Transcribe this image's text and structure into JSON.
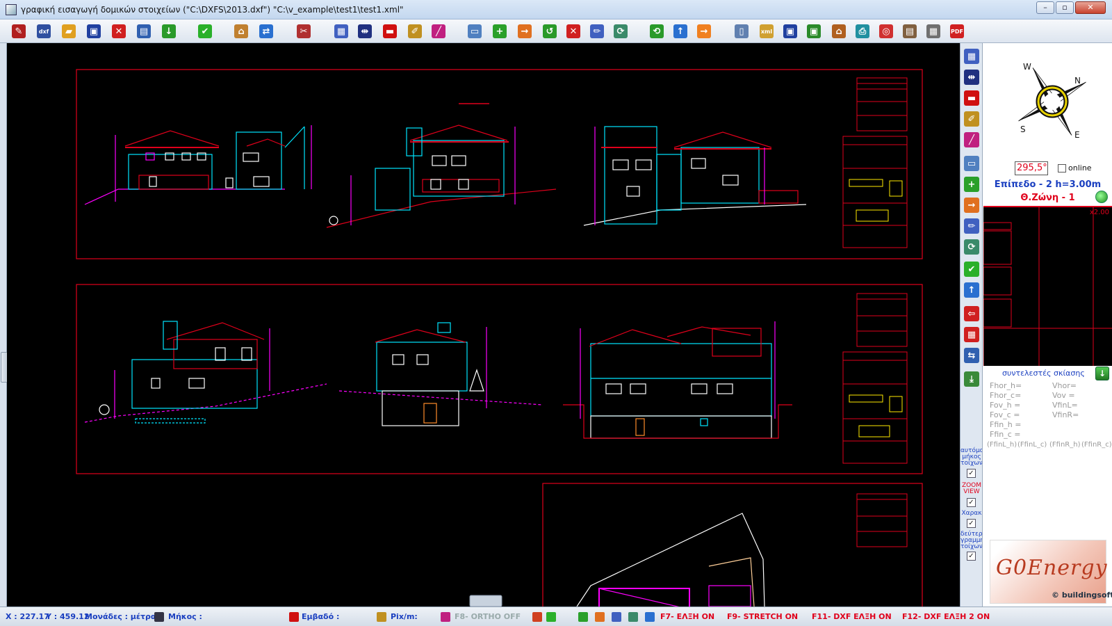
{
  "window": {
    "title": "γραφική εισαγωγή δομικών στοιχείων (\"C:\\DXFS\\2013.dxf\") \"C:\\v_example\\test1\\test1.xml\"",
    "minimize": "–",
    "maximize": "▫",
    "close": "✕"
  },
  "toolbar": {
    "items": [
      {
        "name": "edit-tool",
        "glyph": "✎",
        "color": "#b02020"
      },
      {
        "name": "dxf-import",
        "glyph": "dxf",
        "color": "#3050a0"
      },
      {
        "name": "open-folder",
        "glyph": "▰",
        "color": "#e0a020"
      },
      {
        "name": "save",
        "glyph": "▣",
        "color": "#2040a0"
      },
      {
        "name": "cancel",
        "glyph": "✕",
        "color": "#d02020"
      },
      {
        "name": "layers",
        "glyph": "▤",
        "color": "#3060b0"
      },
      {
        "name": "down-arrow",
        "glyph": "↓",
        "color": "#2a9a2a"
      },
      {
        "name": "confirm",
        "glyph": "✔",
        "color": "#2ab02a"
      },
      {
        "name": "building",
        "glyph": "⌂",
        "color": "#c08030"
      },
      {
        "name": "swap",
        "glyph": "⇄",
        "color": "#2a70d0"
      },
      {
        "name": "tools",
        "glyph": "✂",
        "color": "#b03030"
      },
      {
        "name": "plan-view",
        "glyph": "▦",
        "color": "#4060c0"
      },
      {
        "name": "dimension",
        "glyph": "⇹",
        "color": "#203080"
      },
      {
        "name": "wall",
        "glyph": "▬",
        "color": "#d01010"
      },
      {
        "name": "draw",
        "glyph": "✐",
        "color": "#c09020"
      },
      {
        "name": "line",
        "glyph": "╱",
        "color": "#c02080"
      },
      {
        "name": "page",
        "glyph": "▭",
        "color": "#5080c0"
      },
      {
        "name": "add",
        "glyph": "+",
        "color": "#2aa02a"
      },
      {
        "name": "move",
        "glyph": "→",
        "color": "#e07020"
      },
      {
        "name": "undo",
        "glyph": "↺",
        "color": "#2a9a2a"
      },
      {
        "name": "delete",
        "glyph": "✕",
        "color": "#d02020"
      },
      {
        "name": "edit-line",
        "glyph": "✏",
        "color": "#4060c0"
      },
      {
        "name": "rotate",
        "glyph": "⟳",
        "color": "#3a8a6a"
      },
      {
        "name": "refresh",
        "glyph": "⟲",
        "color": "#2a9a2a"
      },
      {
        "name": "up",
        "glyph": "↑",
        "color": "#2a70d0"
      },
      {
        "name": "forward",
        "glyph": "→",
        "color": "#f08020"
      },
      {
        "name": "new-doc",
        "glyph": "▯",
        "color": "#6080b0"
      },
      {
        "name": "xml",
        "glyph": "xml",
        "color": "#d0a030"
      },
      {
        "name": "save-2",
        "glyph": "▣",
        "color": "#2040a0"
      },
      {
        "name": "save-green",
        "glyph": "▣",
        "color": "#2a8a2a"
      },
      {
        "name": "building-report",
        "glyph": "⌂",
        "color": "#b06020"
      },
      {
        "name": "print",
        "glyph": "⎙",
        "color": "#2090a0"
      },
      {
        "name": "target",
        "glyph": "◎",
        "color": "#d03030"
      },
      {
        "name": "clipboard",
        "glyph": "▤",
        "color": "#806040"
      },
      {
        "name": "calculator",
        "glyph": "▦",
        "color": "#707070"
      },
      {
        "name": "pdf",
        "glyph": "PDF",
        "color": "#d02020"
      }
    ]
  },
  "right_tools": {
    "labels": {
      "auto_length": "αυτόμα\nμήκος\nτοίχων",
      "zoom_view": "ZOOM\nVIEW",
      "charak": "Χαρακ",
      "second_line": "δεύτερη\nγραμμή\nτοίχων"
    }
  },
  "side_panel": {
    "angle": "295,5°",
    "online_label": "online",
    "level": "Επίπεδο - 2  h=3.00m",
    "zone": "Θ.Ζώνη - 1",
    "zoom": "x2.00",
    "shade_title": "συντελεστές σκίασης",
    "coefficients_left": [
      "Fhor_h=",
      "Fhor_c=",
      "Fov_h =",
      "Fov_c =",
      "Ffin_h =",
      "Ffin_c ="
    ],
    "coefficients_right": [
      "Vhor=",
      "Vov =",
      "VfinL=",
      "VfinR="
    ],
    "coefficients_bottom": [
      "(FfinL_h)",
      "(FfinL_c)",
      "(FfinR_h)",
      "(FfinR_c)"
    ],
    "logo_text": "G0Energy",
    "logo_sub": "© buildingsoft",
    "compass_letters": {
      "n": "N",
      "s": "S",
      "e": "E",
      "w": "W"
    }
  },
  "status": {
    "x": "X : 227.17",
    "y": "Y : 459.12",
    "units": "Μονάδες : μέτρα",
    "length": "Μήκος :",
    "area": "Εμβαδό :",
    "pixm": "Pix/m:",
    "ortho": "F8- ORTHO OFF",
    "f7": "F7- ΕΛΞΗ ON",
    "f9": "F9- STRETCH ON",
    "f11": "F11- DXF ΕΛΞΗ ON",
    "f12": "F12- DXF ΕΛΞΗ 2 ON"
  }
}
